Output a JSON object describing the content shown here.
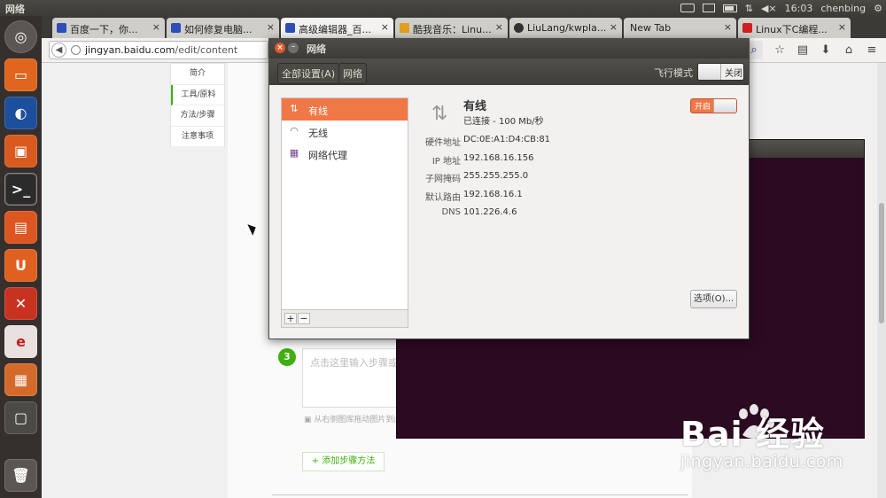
{
  "top_panel": {
    "app_title": "网络",
    "time": "16:03",
    "user": "chenbing"
  },
  "browser": {
    "tabs": [
      {
        "label": "百度一下，你...",
        "fav_color": "#2d4db8"
      },
      {
        "label": "如何修复电脑...",
        "fav_color": "#2d4db8"
      },
      {
        "label": "高级编辑器_百...",
        "fav_color": "#2d4db8"
      },
      {
        "label": "酷我音乐：Linu...",
        "fav_color": "#e0a020"
      },
      {
        "label": "LiuLang/kwpla...",
        "fav_color": "#333333"
      },
      {
        "label": "New Tab",
        "fav_color": ""
      },
      {
        "label": "Linux下C编程...",
        "fav_color": "#d02020"
      }
    ],
    "url_host": "jingyan.baidu.com",
    "url_path": "/edit/content"
  },
  "page": {
    "side_nav": [
      "简介",
      "工具/原料",
      "方法/步骤",
      "注意事项"
    ],
    "step_number": "3",
    "step_placeholder": "点击这里输入步骤或",
    "image_hint": "从右侧图库拖动图片到此",
    "add_step": "+ 添加步骤方法"
  },
  "dialog": {
    "title": "网络",
    "all_settings": "全部设置(A)",
    "breadcrumb": "网络",
    "airplane_mode": "飞行模式",
    "airplane_state": "关闭",
    "connections": [
      {
        "label": "有线",
        "icon": "wired-icon"
      },
      {
        "label": "无线",
        "icon": "wifi-icon"
      },
      {
        "label": "网络代理",
        "icon": "proxy-icon"
      }
    ],
    "detail": {
      "name": "有线",
      "status": "已连接 - 100 Mb/秒",
      "toggle_label": "开启",
      "rows": [
        {
          "key": "硬件地址",
          "value": "DC:0E:A1:D4:CB:81"
        },
        {
          "key": "IP 地址",
          "value": "192.168.16.156"
        },
        {
          "key": "子网掩码",
          "value": "255.255.255.0"
        },
        {
          "key": "默认路由",
          "value": "192.168.16.1"
        },
        {
          "key": "DNS",
          "value": "101.226.4.6"
        }
      ],
      "options_button": "选项(O)..."
    }
  },
  "watermark": {
    "brand": "Bai 经验",
    "sub": "jingyan.baidu.com"
  },
  "colors": {
    "accent": "#f07746",
    "baidu_green": "#3eaf0e",
    "terminal_bg": "#2c0a22"
  }
}
